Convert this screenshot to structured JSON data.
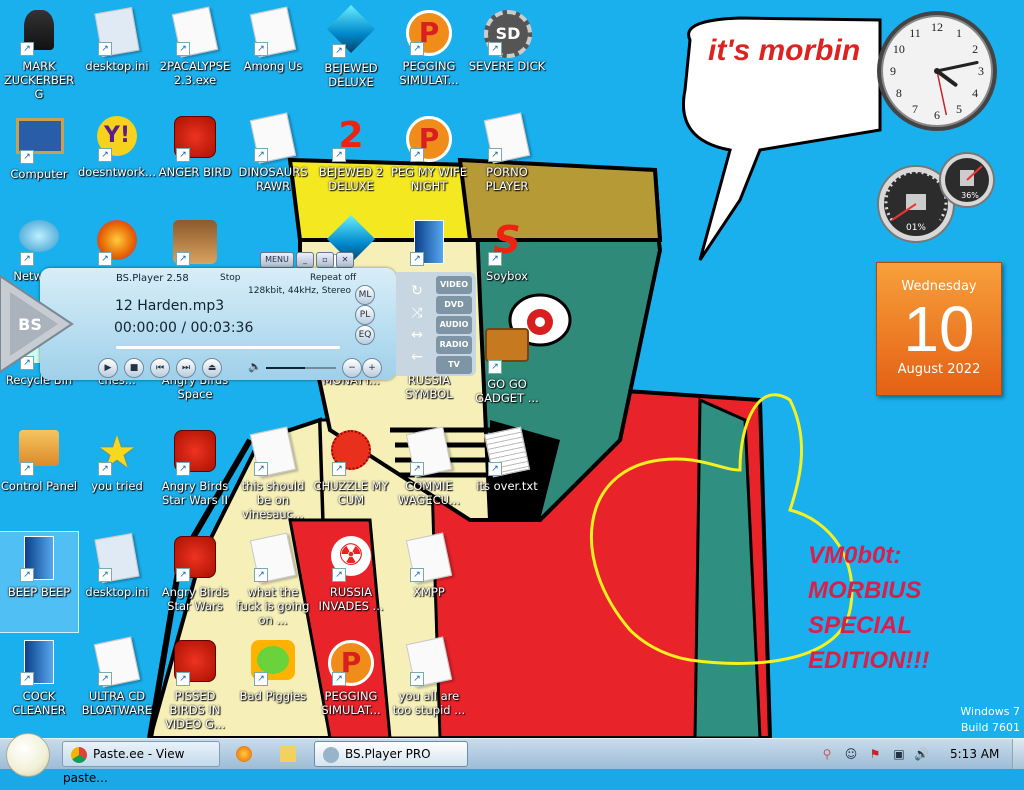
{
  "desktop_icons": [
    {
      "label": "MARK ZUCKERBERG",
      "icon": "person-icon",
      "col": 0,
      "row": 0
    },
    {
      "label": "desktop.ini",
      "icon": "settings-file-icon",
      "col": 1,
      "row": 0
    },
    {
      "label": "2PACALYPSE 2.3.exe",
      "icon": "blank-file-icon",
      "col": 2,
      "row": 0
    },
    {
      "label": "Among Us",
      "icon": "blank-file-icon",
      "col": 3,
      "row": 0
    },
    {
      "label": "BEJEWED DELUXE",
      "icon": "gem-icon",
      "col": 4,
      "row": 0
    },
    {
      "label": "PEGGING SIMULAT...",
      "icon": "p-logo-icon",
      "col": 5,
      "row": 0
    },
    {
      "label": "SEVERE DICK",
      "icon": "sd-gear-icon",
      "col": 6,
      "row": 0
    },
    {
      "label": "Computer",
      "icon": "computer-icon",
      "col": 0,
      "row": 1
    },
    {
      "label": "doesntwork...",
      "icon": "yahoo-messenger-icon",
      "col": 1,
      "row": 1
    },
    {
      "label": "ANGER BIRD",
      "icon": "angry-bird-icon",
      "col": 2,
      "row": 1
    },
    {
      "label": "DINOSAURS RAWR",
      "icon": "blank-file-icon",
      "col": 3,
      "row": 1
    },
    {
      "label": "BEJEWED 2 DELUXE",
      "icon": "number-2-icon",
      "col": 4,
      "row": 1
    },
    {
      "label": "PEG MY WIFE NIGHT",
      "icon": "p-logo-icon",
      "col": 5,
      "row": 1
    },
    {
      "label": "PORNO PLAYER",
      "icon": "blank-file-icon",
      "col": 6,
      "row": 1
    },
    {
      "label": "Networ...",
      "icon": "network-icon",
      "col": 0,
      "row": 2
    },
    {
      "label": "",
      "icon": "firefox-icon",
      "col": 1,
      "row": 2
    },
    {
      "label": "",
      "icon": "angry-birds-seasons-icon",
      "col": 2,
      "row": 2
    },
    {
      "label": "",
      "icon": "gem-icon",
      "col": 4,
      "row": 2
    },
    {
      "label": "",
      "icon": "blue-panel-icon",
      "col": 5,
      "row": 2
    },
    {
      "label": "Soybox",
      "icon": "soybox-s-icon",
      "col": 6,
      "row": 2
    },
    {
      "label": "Recycle Bin",
      "icon": "recycle-bin-icon",
      "col": 0,
      "row": 3
    },
    {
      "label": "ches...",
      "icon": "blank-file-icon",
      "col": 1,
      "row": 3
    },
    {
      "label": "Angry Birds Space",
      "icon": "angry-bird-icon",
      "col": 2,
      "row": 3
    },
    {
      "label": "MONAYY...",
      "icon": "blank-file-icon",
      "col": 4,
      "row": 3
    },
    {
      "label": "RUSSIA SYMBOL",
      "icon": "blank-file-icon",
      "col": 5,
      "row": 3
    },
    {
      "label": "GO GO GADGET ...",
      "icon": "briefcase-icon",
      "col": 6,
      "row": 3
    },
    {
      "label": "Control Panel",
      "icon": "control-panel-icon",
      "col": 0,
      "row": 4
    },
    {
      "label": "you tried",
      "icon": "star-icon",
      "col": 1,
      "row": 4
    },
    {
      "label": "Angry Birds Star Wars II",
      "icon": "angry-bird-icon",
      "col": 2,
      "row": 4
    },
    {
      "label": "this should be on vinesauc...",
      "icon": "blank-file-icon",
      "col": 3,
      "row": 4
    },
    {
      "label": "CHUZZLE MY CUM",
      "icon": "chuzzle-icon",
      "col": 4,
      "row": 4
    },
    {
      "label": "COMMIE WAGECU...",
      "icon": "blank-file-icon",
      "col": 5,
      "row": 4
    },
    {
      "label": "its over.txt",
      "icon": "text-file-icon",
      "col": 6,
      "row": 4
    },
    {
      "label": "BEEP BEEP",
      "icon": "blue-panel-icon",
      "col": 0,
      "row": 5,
      "selected": true
    },
    {
      "label": "desktop.ini",
      "icon": "settings-file-icon",
      "col": 1,
      "row": 5
    },
    {
      "label": "Angry Birds Star Wars",
      "icon": "angry-bird-icon",
      "col": 2,
      "row": 5
    },
    {
      "label": "what the fuck is going on ...",
      "icon": "blank-file-icon",
      "col": 3,
      "row": 5
    },
    {
      "label": "RUSSIA INVADES ...",
      "icon": "radiation-icon",
      "col": 4,
      "row": 5
    },
    {
      "label": "XMPP",
      "icon": "blank-file-icon",
      "col": 5,
      "row": 5
    },
    {
      "label": "COCK CLEANER",
      "icon": "blue-panel-icon",
      "col": 0,
      "row": 6
    },
    {
      "label": "ULTRA CD BLOATWARE",
      "icon": "blank-file-icon",
      "col": 1,
      "row": 6
    },
    {
      "label": "PISSED BIRDS IN VIDEO G...",
      "icon": "angry-bird-icon",
      "col": 2,
      "row": 6
    },
    {
      "label": "Bad Piggies",
      "icon": "pig-icon",
      "col": 3,
      "row": 6
    },
    {
      "label": "PEGGING SIMULAT...",
      "icon": "p-logo-icon",
      "col": 4,
      "row": 6
    },
    {
      "label": "you all are too stupid ...",
      "icon": "blank-file-icon",
      "col": 5,
      "row": 6
    }
  ],
  "bsplayer": {
    "title": "BS.Player 2.58",
    "menu": "MENU",
    "status": "Stop",
    "repeat": "Repeat off",
    "info": "128kbit, 44kHz, Stereo",
    "track": "12 Harden.mp3",
    "time": "00:00:00 / 00:03:36",
    "progress": 0,
    "volume": 0.55,
    "side_buttons": [
      "ML",
      "PL",
      "EQ"
    ],
    "tabs": [
      "VIDEO",
      "DVD",
      "AUDIO",
      "RADIO",
      "TV"
    ],
    "logo": "BS"
  },
  "widgets": {
    "bubble": "it's morbin",
    "clock": {
      "hour": 4,
      "minute": 13,
      "second": 28
    },
    "cpu_percent": "01%",
    "mem_percent": "36%",
    "calendar": {
      "weekday": "Wednesday",
      "day": "10",
      "month_year": "August 2022"
    },
    "vm_text": [
      "VM0b0t:",
      "MORBIUS",
      "SPECIAL",
      "EDITION!!!"
    ]
  },
  "windows_version": {
    "line1": "Windows 7",
    "line2": "Build 7601"
  },
  "taskbar": {
    "items": [
      {
        "label": "Paste.ee - View paste...",
        "icon": "chrome-icon",
        "kind": "btn"
      },
      {
        "label": "",
        "icon": "firefox-icon",
        "kind": "pinned"
      },
      {
        "label": "",
        "icon": "folder-icon",
        "kind": "pinned"
      },
      {
        "label": "BS.Player PRO",
        "icon": "bsplayer-icon",
        "kind": "active"
      }
    ],
    "time": "5:13 AM"
  },
  "colors": {
    "desktop": "#1ab0ee",
    "calendar": "#ee7a22",
    "vm_text": "#d8204a",
    "bubble_text": "#d22222"
  }
}
